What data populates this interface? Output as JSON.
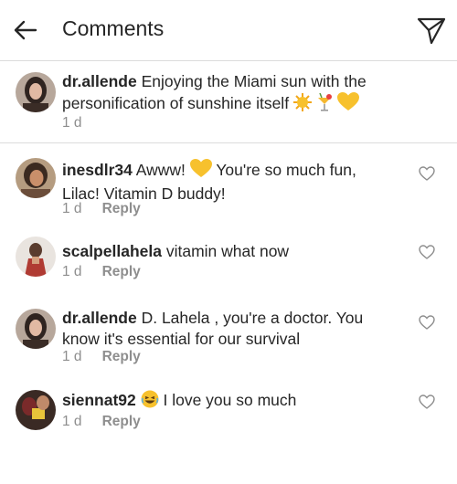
{
  "header": {
    "title": "Comments"
  },
  "caption": {
    "username": "dr.allende",
    "text": "Enjoying the Miami sun with the personification of sunshine itself",
    "emojis": [
      "sun",
      "tropical-drink",
      "yellow-heart"
    ],
    "time": "1 d"
  },
  "comments": [
    {
      "username": "inesdlr34",
      "text_before": "Awww!",
      "emoji": "yellow-heart",
      "text_after": "You're so much fun, Lilac! Vitamin D buddy!",
      "time": "1 d",
      "reply_label": "Reply"
    },
    {
      "username": "scalpellahela",
      "text": "vitamin what now",
      "time": "1 d",
      "reply_label": "Reply"
    },
    {
      "username": "dr.allende",
      "text": "D. Lahela , you're a doctor. You know it's essential for our survival",
      "time": "1 d",
      "reply_label": "Reply"
    },
    {
      "username": "siennat92",
      "emoji": "laughing-face",
      "text": "I love you so much",
      "time": "1 d",
      "reply_label": "Reply"
    }
  ],
  "colors": {
    "text": "#262626",
    "muted": "#8e8e8e",
    "divider": "#dbdbdb",
    "emoji_yellow": "#f7c12d"
  }
}
